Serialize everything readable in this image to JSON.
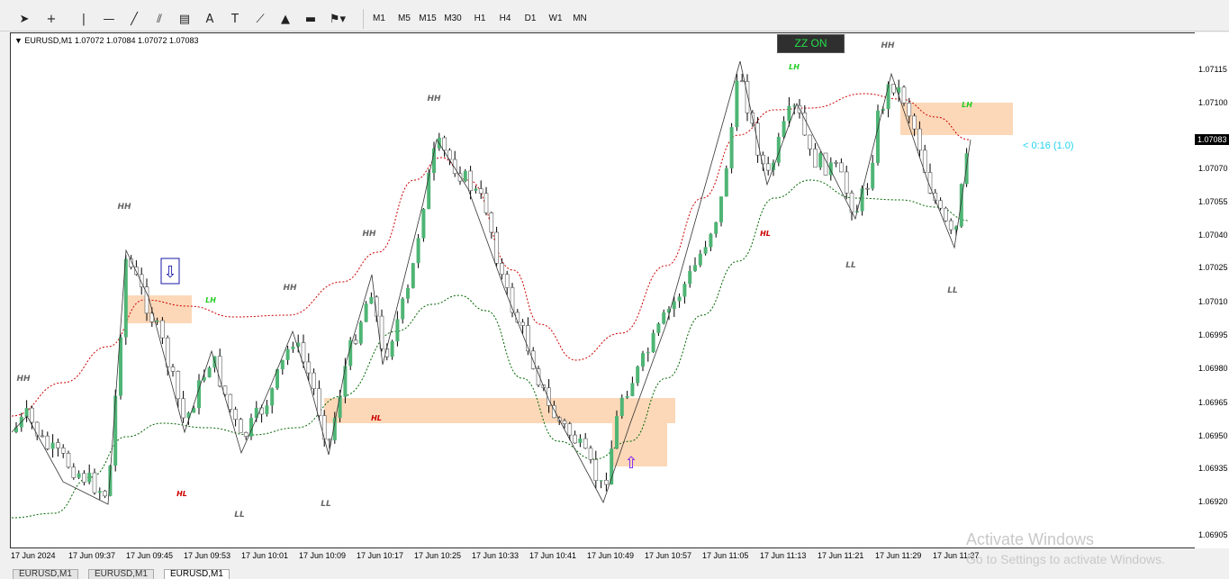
{
  "toolbar": {
    "tools": [
      {
        "name": "cursor-icon",
        "glyph": "➤"
      },
      {
        "name": "crosshair-icon",
        "glyph": "+"
      },
      {
        "name": "vertical-line-icon",
        "glyph": "|"
      },
      {
        "name": "horizontal-line-icon",
        "glyph": "—"
      },
      {
        "name": "trendline-icon",
        "glyph": "╱"
      },
      {
        "name": "channel-icon",
        "glyph": "⫽"
      },
      {
        "name": "fibonacci-icon",
        "glyph": "▤"
      },
      {
        "name": "text-icon",
        "glyph": "A"
      },
      {
        "name": "text-label-icon",
        "glyph": "T"
      },
      {
        "name": "arrow-icon",
        "glyph": "⟋"
      },
      {
        "name": "triangle-shape-icon",
        "glyph": "▲"
      },
      {
        "name": "rectangle-shape-icon",
        "glyph": "▬"
      },
      {
        "name": "shapes-menu-icon",
        "glyph": "⚑▾"
      }
    ],
    "timeframes": [
      "M1",
      "M5",
      "M15",
      "M30",
      "H1",
      "H4",
      "D1",
      "W1",
      "MN"
    ]
  },
  "chart": {
    "symbol_info": "▼ EURUSD,M1  1.07072 1.07084 1.07072 1.07083",
    "zz_label": "ZZ ON",
    "countdown": "< 0:16 (1.0)",
    "current_price": "1.07083",
    "colors": {
      "bull": "#4fb575",
      "bear": "#ffffff",
      "outline": "#000000",
      "zone": "#fcd8b8",
      "upper_band": "#cc0000",
      "lower_band": "#006600",
      "hh_ll": "#666666",
      "lh": "#22cc22",
      "hl": "#cc0000"
    }
  },
  "price_scale": [
    "1.07115",
    "1.07100",
    "1.07070",
    "1.07055",
    "1.07040",
    "1.07025",
    "1.07010",
    "1.06995",
    "1.06980",
    "1.06965",
    "1.06950",
    "1.06935",
    "1.06920",
    "1.06905"
  ],
  "time_axis": [
    "17 Jun 2024",
    "17 Jun 09:37",
    "17 Jun 09:45",
    "17 Jun 09:53",
    "17 Jun 10:01",
    "17 Jun 10:09",
    "17 Jun 10:17",
    "17 Jun 10:25",
    "17 Jun 10:33",
    "17 Jun 10:41",
    "17 Jun 10:49",
    "17 Jun 10:57",
    "17 Jun 11:05",
    "17 Jun 11:13",
    "17 Jun 11:21",
    "17 Jun 11:29",
    "17 Jun 11:37"
  ],
  "markers": [
    {
      "text": "HH",
      "kind": "hh"
    },
    {
      "text": "HH",
      "kind": "hh"
    },
    {
      "text": "HH",
      "kind": "hh"
    },
    {
      "text": "HH",
      "kind": "hh"
    },
    {
      "text": "HH",
      "kind": "hh"
    },
    {
      "text": "HH",
      "kind": "hh"
    },
    {
      "text": "LL",
      "kind": "ll"
    },
    {
      "text": "LL",
      "kind": "ll"
    },
    {
      "text": "LL",
      "kind": "ll"
    },
    {
      "text": "LL",
      "kind": "ll"
    },
    {
      "text": "HL",
      "kind": "hl"
    },
    {
      "text": "HL",
      "kind": "hl"
    },
    {
      "text": "HL",
      "kind": "hl"
    },
    {
      "text": "LH",
      "kind": "lh"
    },
    {
      "text": "LH",
      "kind": "lh"
    },
    {
      "text": "LH",
      "kind": "lh"
    }
  ],
  "tabs": [
    "EURUSD,M1",
    "EURUSD,M1",
    "EURUSD,M1"
  ],
  "watermark": {
    "title": "Activate Windows",
    "subtitle": "Go to Settings to activate Windows."
  }
}
